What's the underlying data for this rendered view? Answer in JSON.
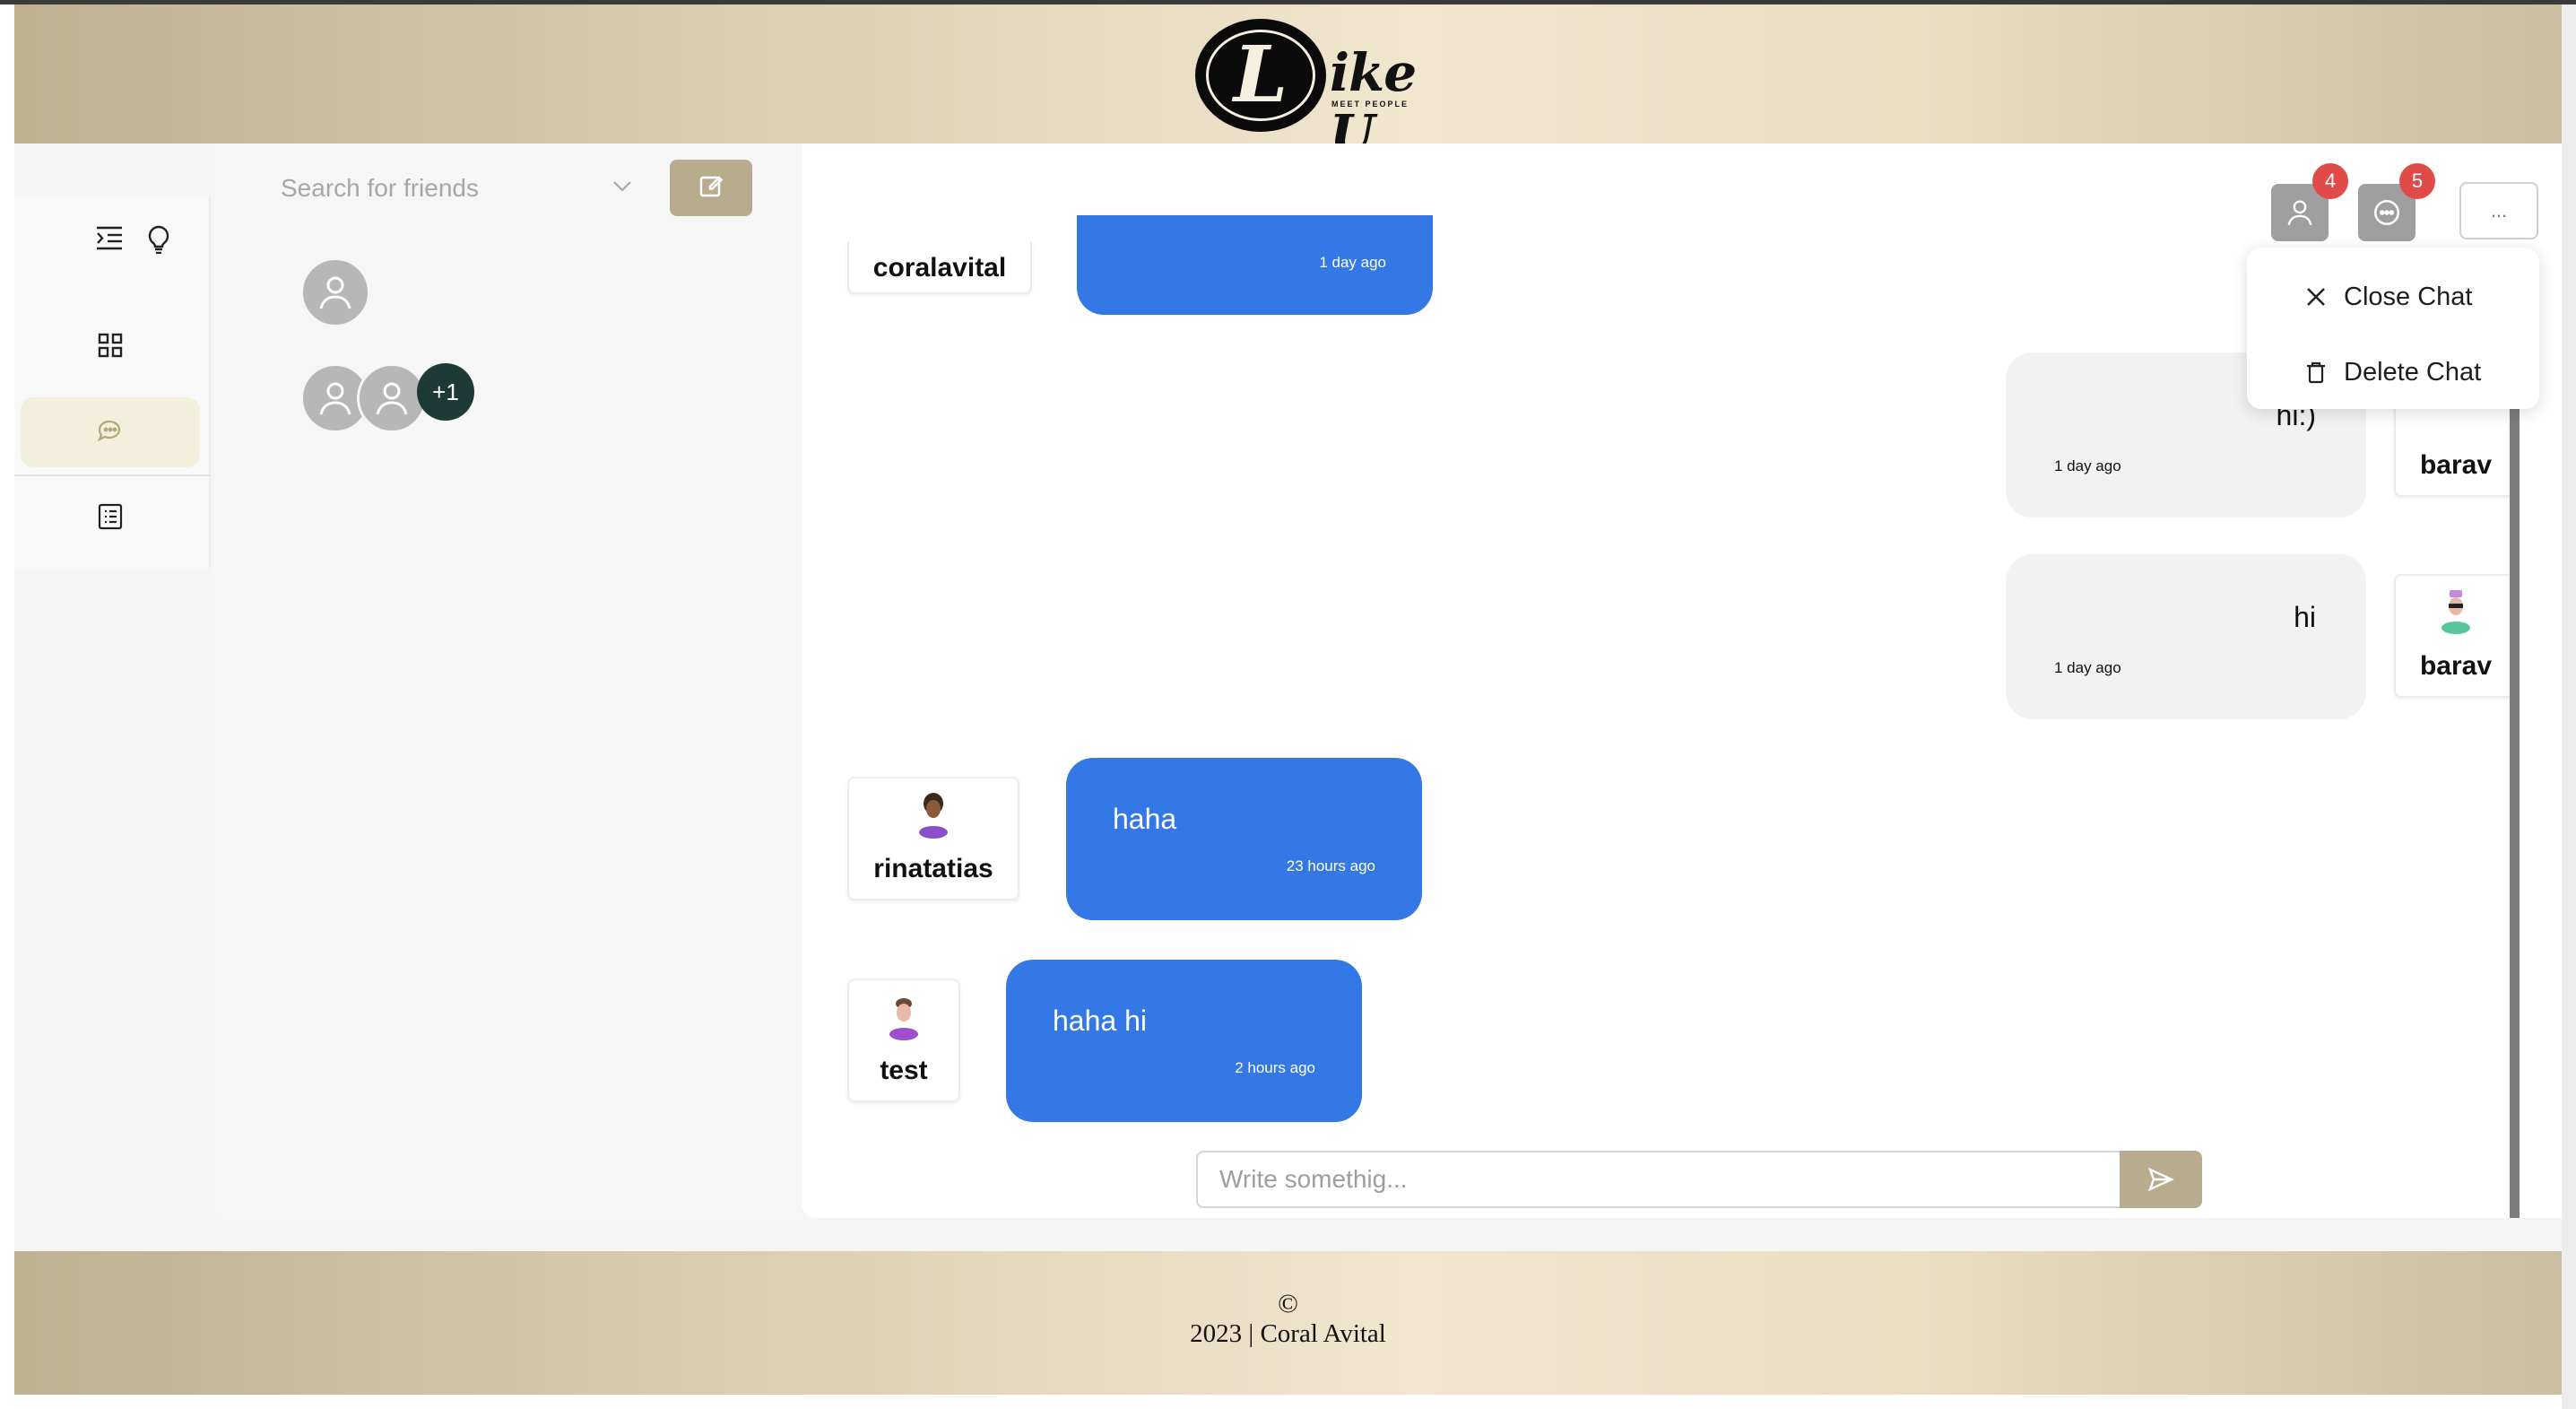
{
  "brand": {
    "logo_letter": "L",
    "logo_text": "ike U",
    "tagline": "MEET PEOPLE"
  },
  "sidebar": {
    "items": [
      {
        "name": "dashboard",
        "icon": "grid-icon"
      },
      {
        "name": "chats",
        "icon": "chat-icon",
        "active": true
      },
      {
        "name": "list",
        "icon": "list-icon"
      }
    ]
  },
  "friends": {
    "search_placeholder": "Search for friends",
    "group_extra": "+1"
  },
  "chat": {
    "badges": {
      "friend_requests": "4",
      "messages": "5"
    },
    "more_label": "...",
    "menu": {
      "close": "Close Chat",
      "delete": "Delete Chat"
    },
    "messages": [
      {
        "user": "coralavital",
        "text": "",
        "time": "1 day ago",
        "side": "left"
      },
      {
        "user": "barav",
        "text": "hi:)",
        "time": "1 day ago",
        "side": "right"
      },
      {
        "user": "barav",
        "text": "hi",
        "time": "1 day ago",
        "side": "right"
      },
      {
        "user": "rinatatias",
        "text": "haha",
        "time": "23 hours ago",
        "side": "left"
      },
      {
        "user": "test",
        "text": "haha hi",
        "time": "2 hours ago",
        "side": "left"
      }
    ],
    "input_placeholder": "Write somethig..."
  },
  "footer": {
    "copyright_symbol": "©",
    "text": "2023 | Coral Avital"
  },
  "colors": {
    "accent": "#b9ab8e",
    "bubble_blue": "#3478e5",
    "badge_red": "#e04a49",
    "active_rail": "#f3efdd"
  }
}
